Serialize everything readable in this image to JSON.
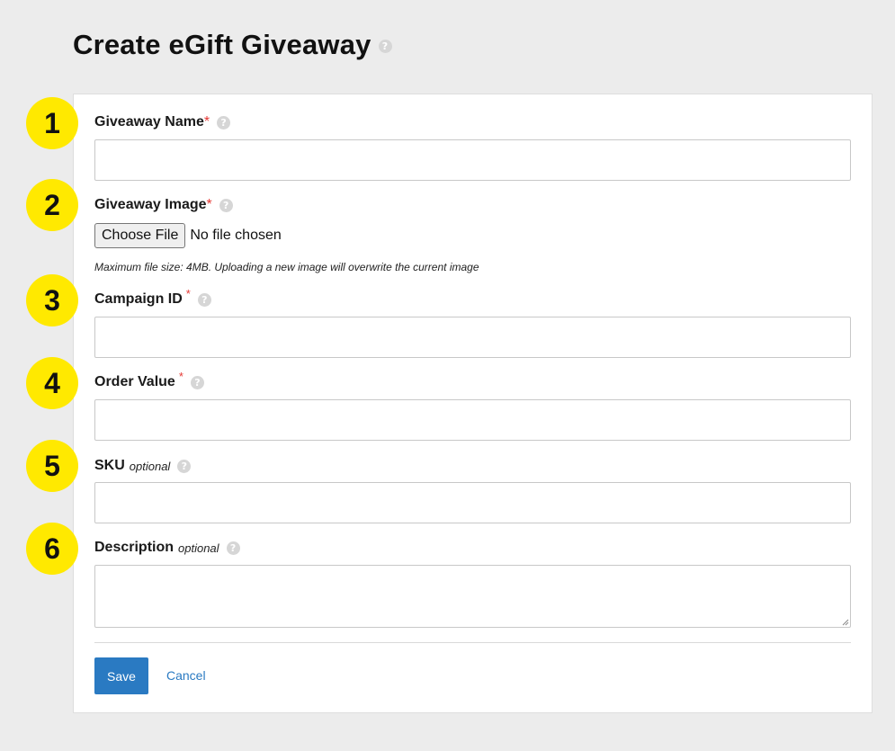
{
  "page": {
    "title": "Create eGift Giveaway",
    "help_glyph": "?"
  },
  "badges": [
    "1",
    "2",
    "3",
    "4",
    "5",
    "6"
  ],
  "fields": {
    "giveaway_name": {
      "label": "Giveaway Name",
      "required_mark": "*"
    },
    "giveaway_image": {
      "label": "Giveaway Image",
      "required_mark": "*",
      "button_label": "Choose File",
      "file_status": "No file chosen",
      "hint": "Maximum file size: 4MB. Uploading a new image will overwrite the current image"
    },
    "campaign_id": {
      "label": "Campaign ID",
      "required_mark": "*"
    },
    "order_value": {
      "label": "Order Value",
      "required_mark": "*"
    },
    "sku": {
      "label": "SKU",
      "optional_label": "optional"
    },
    "description": {
      "label": "Description",
      "optional_label": "optional"
    }
  },
  "actions": {
    "save_label": "Save",
    "cancel_label": "Cancel"
  },
  "colors": {
    "background": "#ececec",
    "badge": "#ffe900",
    "primary": "#2a7ac2",
    "required": "#e53935"
  },
  "icons": [
    "help-icon",
    "resize-grip-icon"
  ]
}
